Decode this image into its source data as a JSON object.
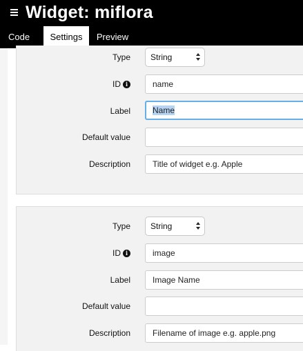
{
  "header": {
    "title": "Widget: miflora"
  },
  "tabs": [
    {
      "label": "Code"
    },
    {
      "label": "Settings"
    },
    {
      "label": "Preview"
    }
  ],
  "settings": [
    {
      "type_label": "Type",
      "type_value": "String",
      "id_label": "ID",
      "id_value": "name",
      "label_label": "Label",
      "label_value": "Name",
      "default_label": "Default value",
      "default_value": "",
      "description_label": "Description",
      "description_value": "Title of widget e.g. Apple"
    },
    {
      "type_label": "Type",
      "type_value": "String",
      "id_label": "ID",
      "id_value": "image",
      "label_label": "Label",
      "label_value": "Image Name",
      "default_label": "Default value",
      "default_value": "",
      "description_label": "Description",
      "description_value": "Filename of image e.g. apple.png"
    }
  ],
  "icons": {
    "menu": "menu-icon",
    "info": "info-icon",
    "select_arrows": "select-arrows-icon"
  },
  "colors": {
    "header_bg": "#000000",
    "focus_border": "#66aee8",
    "selection": "#b5d4f4",
    "card_bg": "#f2f2f2"
  }
}
